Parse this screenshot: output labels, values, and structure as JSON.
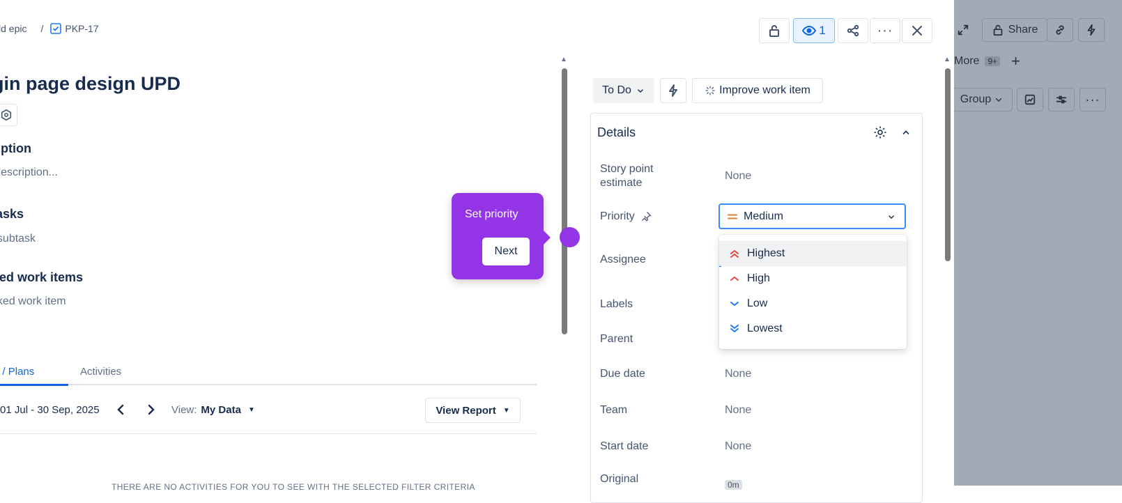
{
  "breadcrumb": {
    "epic": "Add epic",
    "sep": "/",
    "key": "PKP-17"
  },
  "issue": {
    "title": "Login page design UPD"
  },
  "sections": {
    "description_heading": "Description",
    "description_placeholder": "Add a description...",
    "subtasks_heading": "Subtasks",
    "subtasks_placeholder": "Add subtask",
    "linked_heading": "Linked work items",
    "linked_placeholder": "Add linked work item"
  },
  "tabs": [
    {
      "label": "Worklogs / Plans"
    },
    {
      "label": "Activities"
    }
  ],
  "worklog": {
    "date_range": "01 Jul - 30 Sep, 2025",
    "view_prefix": "View:",
    "view_value": "My Data",
    "report_button": "View Report"
  },
  "empty_message": "THERE ARE NO ACTIVITIES FOR YOU TO SEE WITH THE SELECTED FILTER CRITERIA",
  "toolbar": {
    "watch_count": "1"
  },
  "status": {
    "label": "To Do",
    "improve_label": "Improve work item"
  },
  "details": {
    "heading": "Details",
    "fields": {
      "story_point_label": "Story point estimate",
      "story_point_value": "None",
      "priority_label": "Priority",
      "priority_value": "Medium",
      "assignee_label": "Assignee",
      "labels_label": "Labels",
      "parent_label": "Parent",
      "due_date_label": "Due date",
      "due_date_value": "None",
      "team_label": "Team",
      "team_value": "None",
      "start_date_label": "Start date",
      "start_date_value": "None",
      "original_label": "Original",
      "original_value": "0m"
    }
  },
  "priority_options": [
    {
      "label": "Highest",
      "color": "#e2483d"
    },
    {
      "label": "High",
      "color": "#e2483d"
    },
    {
      "label": "Low",
      "color": "#1d7afc"
    },
    {
      "label": "Lowest",
      "color": "#1d7afc"
    }
  ],
  "tooltip": {
    "text": "Set priority",
    "next_label": "Next",
    "color": "#9334e6"
  },
  "background": {
    "share_label": "Share",
    "more_label": "More",
    "more_badge": "9+",
    "group_label": "Group"
  },
  "colors": {
    "accent": "#0c66e4",
    "overlay": "#a3a9b5",
    "tab_active": "#0c66e4"
  }
}
